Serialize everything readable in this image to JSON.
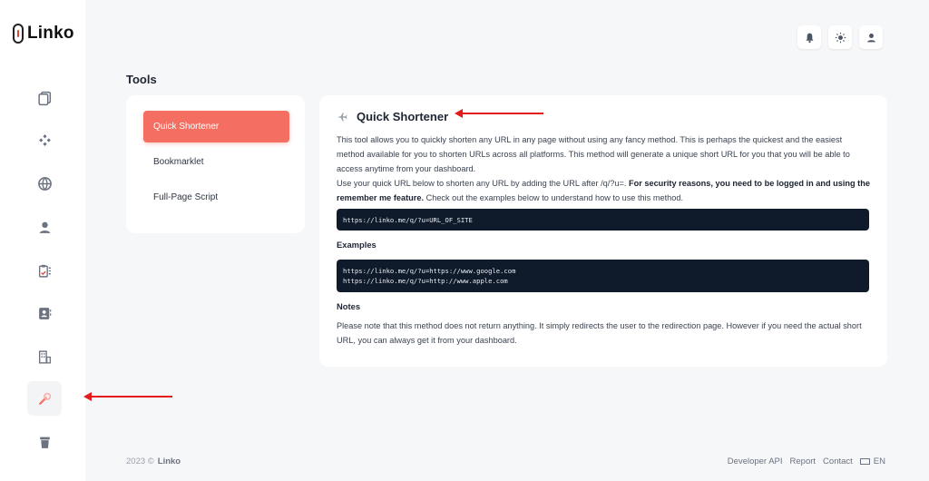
{
  "brand": {
    "name": "Linko"
  },
  "topbar": {
    "icons": [
      "bell-icon",
      "sun-icon",
      "user-icon"
    ]
  },
  "sidebar": {
    "items": [
      {
        "icon": "copy-icon",
        "name": "links"
      },
      {
        "icon": "shapes-icon",
        "name": "bio"
      },
      {
        "icon": "globe-icon",
        "name": "domains"
      },
      {
        "icon": "user-icon",
        "name": "profile"
      },
      {
        "icon": "clipboard-icon",
        "name": "reports"
      },
      {
        "icon": "contact-card-icon",
        "name": "contacts"
      },
      {
        "icon": "building-icon",
        "name": "teams"
      },
      {
        "icon": "tools-icon",
        "name": "tools",
        "active": true
      },
      {
        "icon": "trash-icon",
        "name": "trash"
      }
    ]
  },
  "page": {
    "title": "Tools"
  },
  "tools_menu": {
    "items": [
      {
        "label": "Quick Shortener",
        "active": true
      },
      {
        "label": "Bookmarklet"
      },
      {
        "label": "Full-Page Script"
      }
    ]
  },
  "main": {
    "title": "Quick Shortener",
    "intro": "This tool allows you to quickly shorten any URL in any page without using any fancy method. This is perhaps the quickest and the easiest method available for you to shorten URLs across all platforms. This method will generate a unique short URL for you that you will be able to access anytime from your dashboard.",
    "usage_prefix": "Use your quick URL below to shorten any URL by adding the URL after /q/?u=. ",
    "usage_bold": "For security reasons, you need to be logged in and using the remember me feature.",
    "usage_suffix": " Check out the examples below to understand how to use this method.",
    "code_template": "https://linko.me/q/?u=URL_OF_SITE",
    "examples_heading": "Examples",
    "example_1": "https://linko.me/q/?u=https://www.google.com",
    "example_2": "https://linko.me/q/?u=http://www.apple.com",
    "notes_heading": "Notes",
    "notes": "Please note that this method does not return anything. It simply redirects the user to the redirection page. However if you need the actual short URL, you can always get it from your dashboard."
  },
  "footer": {
    "copyright": "2023 ©",
    "brand": "Linko",
    "links": [
      "Developer API",
      "Report",
      "Contact"
    ],
    "language": "EN"
  },
  "colors": {
    "accent": "#f46e62",
    "code_bg": "#0f1a2a",
    "annotation_arrow": "#e31b1b"
  }
}
